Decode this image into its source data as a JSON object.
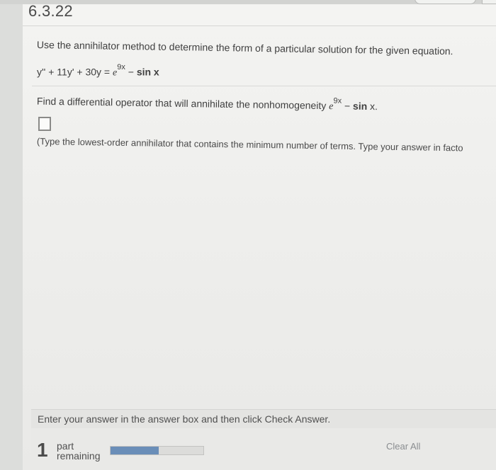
{
  "problem": {
    "number": "6.3.22",
    "instruction": "Use the annihilator method to determine the form of a particular solution for the given equation.",
    "equation": {
      "lhs": "y'' + 11y' + 30y = ",
      "e": "e",
      "exponent": "9x",
      "minus": " − ",
      "sin": "sin x"
    },
    "operator_prompt": {
      "text": "Find a differential operator that will annihilate the nonhomogeneity ",
      "e": "e",
      "exponent": "9x",
      "minus": " − ",
      "sin": "sin",
      "x": " x."
    },
    "answer_value": "",
    "hint": "(Type the lowest-order annihilator that contains the minimum number of terms. Type your answer in facto"
  },
  "footer": {
    "instruction": "Enter your answer in the answer box and then click Check Answer.",
    "parts_remaining_count": "1",
    "parts_label_line1": "part",
    "parts_label_line2": "remaining",
    "progress_fraction": 0.52,
    "clear_all_label": "Clear All"
  },
  "colors": {
    "progress_fill": "#6a8eb8",
    "background": "#efefed"
  }
}
